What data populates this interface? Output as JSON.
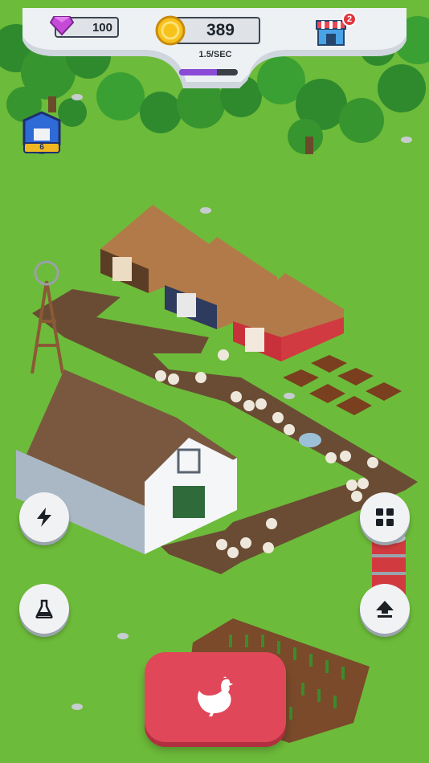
{
  "hud": {
    "gems": "100",
    "coins": "389",
    "rate": "1.5/SEC",
    "progress_fraction": 0.65,
    "shop_badge": "2"
  },
  "crest": {
    "level": "6"
  },
  "buttons": {
    "boost_icon": "lightning-icon",
    "research_icon": "flask-icon",
    "menu_icon": "grid-icon",
    "upgrade_icon": "upload-arrow-icon",
    "main_action_icon": "chicken-icon"
  },
  "colors": {
    "grass": "#6dbb3a",
    "main_button": "#e0485a",
    "progress": "#8a4bd6"
  }
}
